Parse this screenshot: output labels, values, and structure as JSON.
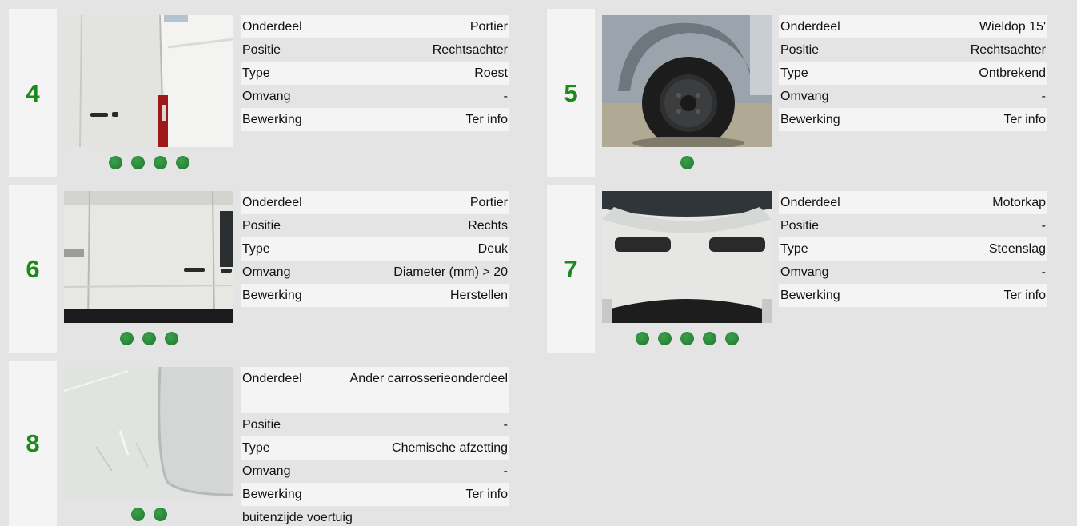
{
  "cards": [
    {
      "number": "4",
      "photo_alt": "Portier rechtsachter",
      "dots": 4,
      "rows": [
        {
          "key": "Onderdeel",
          "value": "Portier"
        },
        {
          "key": "Positie",
          "value": "Rechtsachter"
        },
        {
          "key": "Type",
          "value": "Roest"
        },
        {
          "key": "Omvang",
          "value": "-"
        },
        {
          "key": "Bewerking",
          "value": "Ter info"
        }
      ]
    },
    {
      "number": "5",
      "photo_alt": "Wieldop rechtsachter",
      "dots": 1,
      "rows": [
        {
          "key": "Onderdeel",
          "value": "Wieldop 15'"
        },
        {
          "key": "Positie",
          "value": "Rechtsachter"
        },
        {
          "key": "Type",
          "value": "Ontbrekend"
        },
        {
          "key": "Omvang",
          "value": "-"
        },
        {
          "key": "Bewerking",
          "value": "Ter info"
        }
      ]
    },
    {
      "number": "6",
      "photo_alt": "Portier rechts",
      "dots": 3,
      "rows": [
        {
          "key": "Onderdeel",
          "value": "Portier"
        },
        {
          "key": "Positie",
          "value": "Rechts"
        },
        {
          "key": "Type",
          "value": "Deuk"
        },
        {
          "key": "Omvang",
          "value": "Diameter (mm) > 20"
        },
        {
          "key": "Bewerking",
          "value": "Herstellen"
        }
      ]
    },
    {
      "number": "7",
      "photo_alt": "Motorkap",
      "dots": 5,
      "rows": [
        {
          "key": "Onderdeel",
          "value": "Motorkap"
        },
        {
          "key": "Positie",
          "value": "-"
        },
        {
          "key": "Type",
          "value": "Steenslag"
        },
        {
          "key": "Omvang",
          "value": "-"
        },
        {
          "key": "Bewerking",
          "value": "Ter info"
        }
      ]
    },
    {
      "number": "8",
      "photo_alt": "Ander carrosserieonderdeel",
      "dots": 2,
      "rows": [
        {
          "key": "Onderdeel",
          "value": "Ander carrosserieonderdeel"
        },
        {
          "key": "Positie",
          "value": "-"
        },
        {
          "key": "Type",
          "value": "Chemische afzetting"
        },
        {
          "key": "Omvang",
          "value": "-"
        },
        {
          "key": "Bewerking",
          "value": "Ter info"
        }
      ],
      "note": "buitenzijde voertuig"
    }
  ],
  "colors": {
    "accent_number": "#1b8a1b",
    "dot": "#2c8a3c",
    "background": "#e4e4e4",
    "row_alt": "#f4f4f4"
  }
}
